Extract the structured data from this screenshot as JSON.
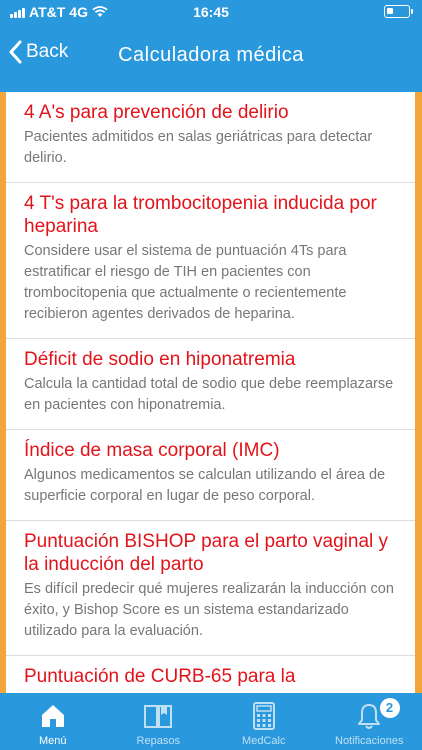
{
  "status": {
    "carrier": "AT&T",
    "network": "4G",
    "time": "16:45"
  },
  "nav": {
    "back_label": "Back",
    "title": "Calculadora médica"
  },
  "items": [
    {
      "title": "4 A's para prevención de delirio",
      "desc": "Pacientes admitidos en salas geriátricas para detectar delirio."
    },
    {
      "title": "4 T's para la trombocitopenia inducida por heparina",
      "desc": "Considere usar el sistema de puntuación 4Ts para estratificar el riesgo de TIH en pacientes con trombocitopenia que actualmente o recientemente recibieron agentes derivados de heparina."
    },
    {
      "title": "Déficit de sodio en hiponatremia",
      "desc": "Calcula la cantidad total de sodio que debe reemplazarse en pacientes con hiponatremia."
    },
    {
      "title": "Índice de masa corporal (IMC)",
      "desc": "Algunos medicamentos se calculan utilizando el área de superficie corporal en lugar de peso corporal."
    },
    {
      "title": "Puntuación BISHOP para el parto vaginal y la inducción del parto",
      "desc": "Es difícil predecir qué mujeres realizarán la inducción con éxito, y Bishop Score es un sistema estandarizado utilizado para la evaluación."
    },
    {
      "title": "Puntuación de CURB-65 para la",
      "desc": ""
    }
  ],
  "tabs": [
    {
      "label": "Menú",
      "icon": "home-icon",
      "active": true
    },
    {
      "label": "Repasos",
      "icon": "book-icon",
      "active": false
    },
    {
      "label": "MedCalc",
      "icon": "calculator-icon",
      "active": false
    },
    {
      "label": "Notificaciones",
      "icon": "bell-icon",
      "active": false,
      "badge": "2"
    }
  ],
  "colors": {
    "header": "#2a98dc",
    "accent_side": "#f2a63a",
    "item_title": "#e2141b"
  }
}
